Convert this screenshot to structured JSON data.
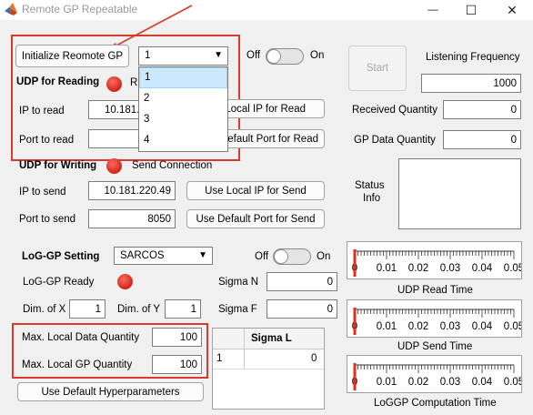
{
  "window": {
    "title": "Remote GP Repeatable",
    "minimize_glyph": "—",
    "maximize_glyph": "☐",
    "close_glyph": "✕",
    "app_icon": "matlab-logo-icon"
  },
  "controls": {
    "init_button": "Initialize Reomote GP",
    "dropdown_value": "1",
    "dropdown_options": [
      "1",
      "2",
      "3",
      "4"
    ],
    "switch_off": "Off",
    "switch_on": "On",
    "start_button": "Start",
    "listening_frequency_label": "Listening Frequency",
    "listening_frequency_value": "1000",
    "received_quantity_label": "Received Quantity",
    "received_quantity_value": "0",
    "gp_data_quantity_label": "GP Data Quantity",
    "gp_data_quantity_value": "0",
    "status_label_1": "Status",
    "status_label_2": "Info",
    "status_value": ""
  },
  "udp_read": {
    "title": "UDP for Reading",
    "lamp_label": "R",
    "ip_label": "IP to read",
    "ip_value": "10.181.",
    "port_label": "Port to read",
    "port_value": "",
    "local_ip_button": "Local IP for Read",
    "default_port_button": "efault Port for Read"
  },
  "udp_write": {
    "title": "UDP for Writing",
    "lamp_label": "Send Connection",
    "ip_label": "IP to send",
    "ip_value": "10.181.220.49",
    "port_label": "Port to send",
    "port_value": "8050",
    "local_ip_button": "Use Local IP for Send",
    "default_port_button": "Use Default Port for Send"
  },
  "loggp": {
    "title": "LoG-GP Setting",
    "model_value": "SARCOS",
    "switch_off": "Off",
    "switch_on": "On",
    "ready_label": "LoG-GP Ready",
    "sigma_n_label": "Sigma N",
    "sigma_n_value": "0",
    "dim_x_label": "Dim. of X",
    "dim_x_value": "1",
    "dim_y_label": "Dim. of Y",
    "dim_y_value": "1",
    "sigma_f_label": "Sigma F",
    "sigma_f_value": "0",
    "max_local_data_label": "Max. Local Data Quantity",
    "max_local_data_value": "100",
    "max_local_gp_label": "Max. Local GP Quantity",
    "max_local_gp_value": "100",
    "default_hyper_button": "Use Default Hyperparameters",
    "sigma_l_header": "Sigma L",
    "sigma_l_rows": [
      [
        "1",
        "0"
      ]
    ]
  },
  "gauges": {
    "tick_labels": [
      "0",
      "0.01",
      "0.02",
      "0.03",
      "0.04",
      "0.05"
    ],
    "udp_read_label": "UDP Read Time",
    "udp_read_value": 0,
    "udp_send_label": "UDP Send Time",
    "udp_send_value": 0,
    "loggp_label": "LoGGP Computation Time",
    "loggp_value": 0,
    "min": 0,
    "max": 0.05,
    "needle_color": "#e0301e"
  },
  "annotations": {
    "highlight_color": "#d93a2b"
  }
}
